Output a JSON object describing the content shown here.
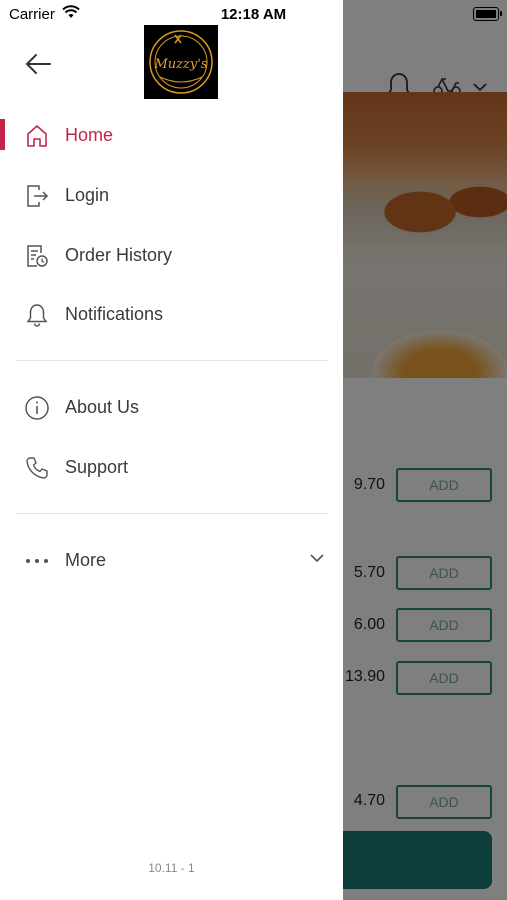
{
  "status_bar": {
    "carrier": "Carrier",
    "time": "12:18 AM"
  },
  "drawer": {
    "logo_text": "Muzzy's",
    "menu": [
      {
        "label": "Home",
        "icon": "home-icon",
        "active": true
      },
      {
        "label": "Login",
        "icon": "login-icon",
        "active": false
      },
      {
        "label": "Order History",
        "icon": "order-history-icon",
        "active": false
      },
      {
        "label": "Notifications",
        "icon": "bell-icon",
        "active": false
      },
      {
        "label": "About Us",
        "icon": "info-icon",
        "active": false
      },
      {
        "label": "Support",
        "icon": "phone-icon",
        "active": false
      },
      {
        "label": "More",
        "icon": "more-dots-icon",
        "active": false
      }
    ],
    "version": "10.11 - 1"
  },
  "background_page": {
    "items": [
      {
        "price": "9.70",
        "add_label": "ADD"
      },
      {
        "price": "5.70",
        "add_label": "ADD"
      },
      {
        "price": "6.00",
        "add_label": "ADD"
      },
      {
        "price": "13.90",
        "add_label": "ADD"
      },
      {
        "price": "4.70",
        "add_label": "ADD"
      }
    ]
  },
  "colors": {
    "accent": "#c1264a",
    "teal": "#1d7c74",
    "overlay": "rgba(0,0,0,0.5)"
  }
}
